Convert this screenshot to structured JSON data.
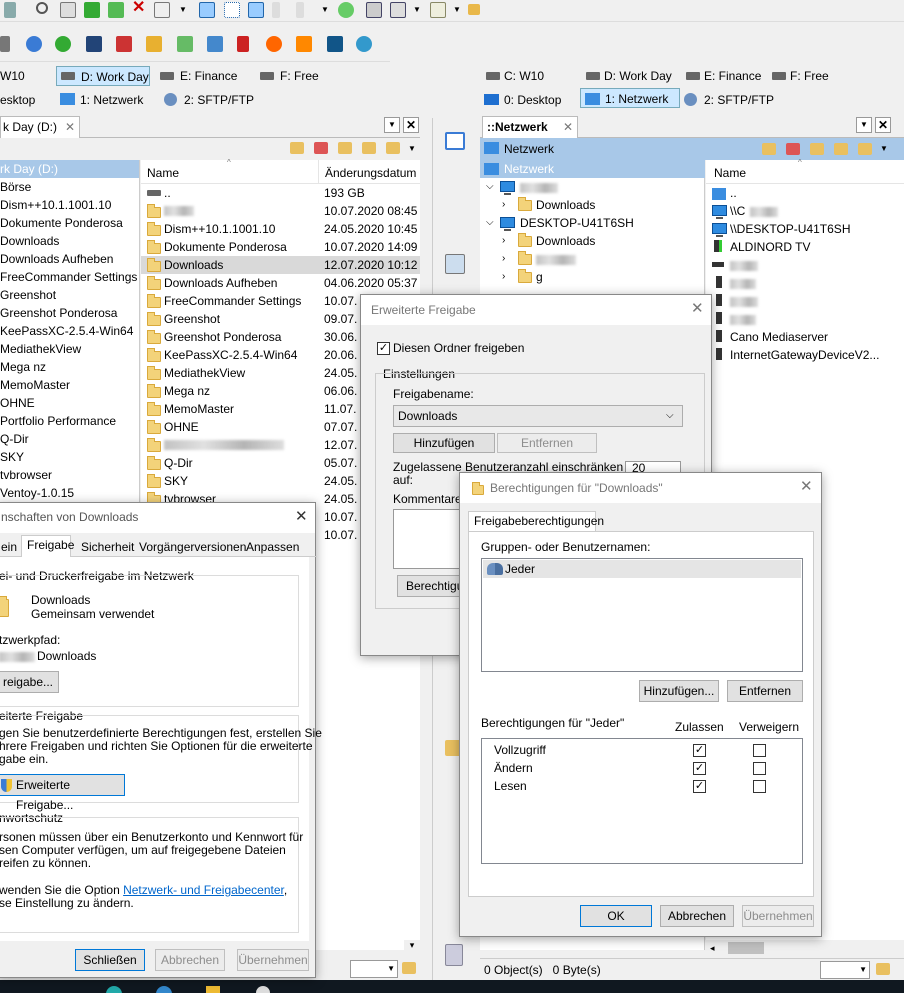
{
  "left_drives_row1": [
    "W10",
    "D: Work Day",
    "E: Finance",
    "F: Free"
  ],
  "left_drives_row2": [
    "esktop",
    "1: Netzwerk",
    "2: SFTP/FTP"
  ],
  "right_drives_row1": [
    "C: W10",
    "D: Work Day",
    "E: Finance",
    "F: Free"
  ],
  "right_drives_row2": [
    "0: Desktop",
    "1: Netzwerk",
    "2: SFTP/FTP"
  ],
  "left_tab": "k Day (D:)",
  "right_tab": "::Netzwerk",
  "left_tree": [
    "rk Day (D:)",
    "Börse",
    "Dism++10.1.1001.10",
    "Dokumente Ponderosa",
    "Downloads",
    "Downloads Aufheben",
    "FreeCommander Settings",
    "Greenshot",
    "Greenshot Ponderosa",
    "KeePassXC-2.5.4-Win64",
    "MediathekView",
    "Mega nz",
    "MemoMaster",
    "OHNE",
    "Portfolio Performance",
    "Q-Dir",
    "SKY",
    "tvbrowser",
    "Ventoy-1.0.15"
  ],
  "left_list_header": {
    "name": "Name",
    "date": "Änderungsdatum"
  },
  "left_list": [
    {
      "name": "..",
      "date": "193 GB"
    },
    {
      "name": "",
      "date": "10.07.2020 08:45"
    },
    {
      "name": "Dism++10.1.1001.10",
      "date": "24.05.2020 10:45"
    },
    {
      "name": "Dokumente Ponderosa",
      "date": "10.07.2020 14:09"
    },
    {
      "name": "Downloads",
      "date": "12.07.2020 10:12"
    },
    {
      "name": "Downloads Aufheben",
      "date": "04.06.2020 05:37"
    },
    {
      "name": "FreeCommander Settings",
      "date": "10.07."
    },
    {
      "name": "Greenshot",
      "date": "09.07."
    },
    {
      "name": "Greenshot Ponderosa",
      "date": "30.06."
    },
    {
      "name": "KeePassXC-2.5.4-Win64",
      "date": "20.06."
    },
    {
      "name": "MediathekView",
      "date": "24.05."
    },
    {
      "name": "Mega nz",
      "date": "06.06."
    },
    {
      "name": "MemoMaster",
      "date": "11.07."
    },
    {
      "name": "OHNE",
      "date": "07.07."
    },
    {
      "name": "",
      "date": "12.07."
    },
    {
      "name": "Q-Dir",
      "date": "05.07."
    },
    {
      "name": "SKY",
      "date": "24.05."
    },
    {
      "name": "tvbrowser",
      "date": "24.05."
    },
    {
      "name": "",
      "date": "10.07."
    },
    {
      "name": "",
      "date": "10.07."
    }
  ],
  "right_tree": {
    "root": "Netzwerk",
    "selected": "Netzwerk",
    "items": [
      "Downloads",
      "DESKTOP-U41T6SH",
      "Downloads",
      "g"
    ]
  },
  "right_list_header": "Name",
  "right_list": [
    "..",
    "\\\\C",
    "\\\\DESKTOP-U41T6SH",
    "ALDINORD TV",
    "Cano Mediaserver",
    "InternetGatewayDeviceV2..."
  ],
  "props_dialog": {
    "title": "nschaften von Downloads",
    "tabs": [
      "ein",
      "Freigabe",
      "Sicherheit",
      "Vorgängerversionen",
      "Anpassen"
    ],
    "section1": "ei- und Druckerfreigabe im Netzwerk",
    "folder_name": "Downloads",
    "folder_state": "Gemeinsam verwendet",
    "path_label": "tzwerkpfad:",
    "path_value": "Downloads",
    "share_button": "reigabe...",
    "section2": "eiterte Freigabe",
    "section2_text": [
      "gen Sie benutzerdefinierte Berechtigungen fest, erstellen Sie",
      "hrere Freigaben und richten Sie Optionen für die erweiterte",
      "gabe ein."
    ],
    "advanced_button": "Erweiterte Freigabe...",
    "section3": "nwortschutz",
    "section3_text": [
      "rsonen müssen über ein Benutzerkonto und Kennwort für",
      "sen Computer verfügen, um auf freigegebene Dateien",
      "reifen zu können."
    ],
    "section3_text2a": "wenden Sie die Option ",
    "section3_link": "Netzwerk- und Freigabecenter",
    "section3_text2b": ",",
    "section3_text3": "se Einstellung zu ändern.",
    "close": "Schließen",
    "cancel": "Abbrechen",
    "apply": "Übernehmen"
  },
  "adv_dialog": {
    "title": "Erweiterte Freigabe",
    "share_checkbox": "Diesen Ordner freigeben",
    "group": "Einstellungen",
    "share_name_label": "Freigabename:",
    "share_name_value": "Downloads",
    "add": "Hinzufügen",
    "remove": "Entfernen",
    "limit_label_1": "Zugelassene Benutzeranzahl einschränken",
    "limit_label_2": "auf:",
    "limit_value": "20",
    "comments": "Kommentare:",
    "permissions_button": "Berechtigun"
  },
  "perm_dialog": {
    "title": "Berechtigungen für \"Downloads\"",
    "tab": "Freigabeberechtigungen",
    "users_label": "Gruppen- oder Benutzernamen:",
    "user": "Jeder",
    "add": "Hinzufügen...",
    "remove": "Entfernen",
    "perm_label": "Berechtigungen für \"Jeder\"",
    "allow": "Zulassen",
    "deny": "Verweigern",
    "rows": [
      {
        "name": "Vollzugriff",
        "allow": true,
        "deny": false
      },
      {
        "name": "Ändern",
        "allow": true,
        "deny": false
      },
      {
        "name": "Lesen",
        "allow": true,
        "deny": false
      }
    ],
    "ok": "OK",
    "cancel": "Abbrechen",
    "apply": "Übernehmen"
  },
  "status_right": "0 Object(s)   0 Byte(s)",
  "colors": {
    "selection": "#cce8ff",
    "titlebar_blue": "#a8c8e8",
    "link": "#0066cc"
  }
}
